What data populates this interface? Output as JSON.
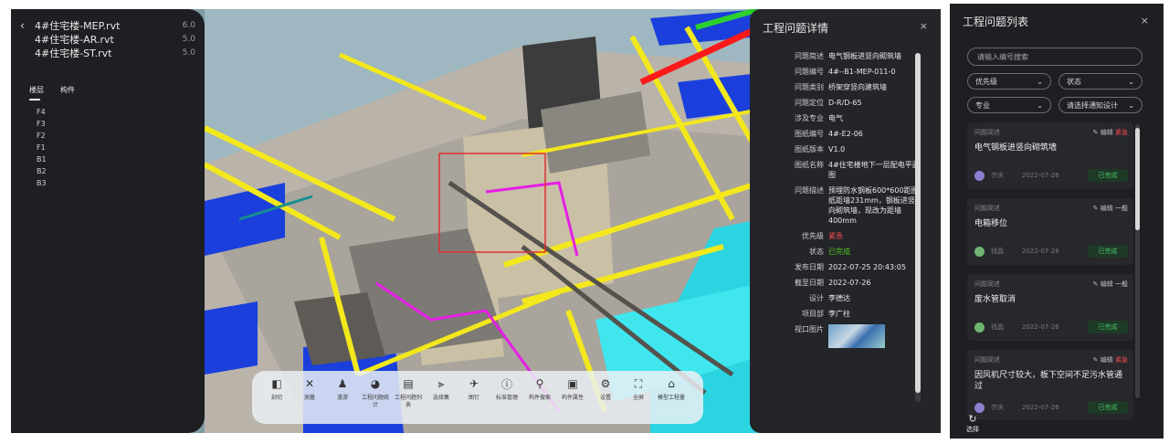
{
  "model_panel": {
    "models": [
      {
        "name": "4#住宅楼-MEP.rvt",
        "version": "6.0"
      },
      {
        "name": "4#住宅楼-AR.rvt",
        "version": "5.0"
      },
      {
        "name": "4#住宅楼-ST.rvt",
        "version": "5.0"
      }
    ],
    "tabs": [
      "楼层",
      "构件"
    ],
    "floors": [
      "F4",
      "F3",
      "F2",
      "F1",
      "B1",
      "B2",
      "B3"
    ]
  },
  "toolbar": {
    "tools": [
      {
        "label": "剖切",
        "icon": "section-icon"
      },
      {
        "label": "测量",
        "icon": "measure-icon"
      },
      {
        "label": "漫游",
        "icon": "walk-icon"
      },
      {
        "label": "工程问题统计",
        "icon": "stats-icon"
      },
      {
        "label": "工程问题列表",
        "icon": "list-icon"
      },
      {
        "label": "选择集",
        "icon": "selection-set-icon"
      },
      {
        "label": "图钉",
        "icon": "pin-icon"
      },
      {
        "label": "标准管理",
        "icon": "info-icon"
      },
      {
        "label": "构件搜索",
        "icon": "search-icon"
      },
      {
        "label": "构件属性",
        "icon": "properties-icon"
      },
      {
        "label": "设置",
        "icon": "gear-icon"
      },
      {
        "label": "全屏",
        "icon": "fullscreen-icon"
      },
      {
        "label": "模型工程量",
        "icon": "quantity-icon"
      }
    ]
  },
  "detail_panel": {
    "title": "工程问题详情",
    "close": "×",
    "rows": [
      {
        "key": "问题简述",
        "value": "电气钢板进竖向砌筑墙",
        "style": ""
      },
      {
        "key": "问题编号",
        "value": "4#--B1-MEP-011-0",
        "style": ""
      },
      {
        "key": "问题类别",
        "value": "桥架穿竖向建筑墙",
        "style": ""
      },
      {
        "key": "问题定位",
        "value": "D-R/D-65",
        "style": ""
      },
      {
        "key": "涉及专业",
        "value": "电气",
        "style": ""
      },
      {
        "key": "图纸编号",
        "value": "4#-E2-06",
        "style": ""
      },
      {
        "key": "图纸版本",
        "value": "V1.0",
        "style": ""
      },
      {
        "key": "图纸名称",
        "value": "4#住宅楼地下一层配电平面图",
        "style": ""
      },
      {
        "key": "问题描述",
        "value": "预埋防水钢板600*600距图纸距墙231mm，钢板进竖向砌筑墙，现改为距墙400mm",
        "style": ""
      },
      {
        "key": "优先级",
        "value": "紧急",
        "style": "red"
      },
      {
        "key": "状态",
        "value": "已完成",
        "style": "green"
      },
      {
        "key": "发布日期",
        "value": "2022-07-25 20:43:05",
        "style": ""
      },
      {
        "key": "截至日期",
        "value": "2022-07-26",
        "style": ""
      },
      {
        "key": "设计",
        "value": "李德达",
        "style": ""
      },
      {
        "key": "项目部",
        "value": "李广柱",
        "style": ""
      },
      {
        "key": "视口图片",
        "value": "",
        "style": "image"
      }
    ]
  },
  "list_panel": {
    "title": "工程问题列表",
    "close": "×",
    "search_placeholder": "请输入编号搜索",
    "filters": {
      "priority": "优先级",
      "status": "状态",
      "discipline": "专业",
      "notify": "请选择通知设计"
    },
    "chevron": "⌄",
    "cards": [
      {
        "title": "问题简述",
        "edit": "编辑",
        "priority": "紧急",
        "priority_style": "red",
        "desc": "电气钢板进竖向砌筑墙",
        "user": "齐庆",
        "date": "2022-07-26",
        "status": "已完成",
        "avatar_color": "#8b7fd1"
      },
      {
        "title": "问题简述",
        "edit": "编辑",
        "priority": "一般",
        "priority_style": "gray",
        "desc": "电箱移位",
        "user": "钱晶",
        "date": "2022-07-26",
        "status": "已完成",
        "avatar_color": "#6fb56f"
      },
      {
        "title": "问题简述",
        "edit": "编辑",
        "priority": "一般",
        "priority_style": "gray",
        "desc": "废水管取消",
        "user": "钱晶",
        "date": "2022-07-26",
        "status": "已完成",
        "avatar_color": "#6fb56f"
      },
      {
        "title": "问题简述",
        "edit": "编辑",
        "priority": "紧急",
        "priority_style": "red",
        "desc": "因风机尺寸较大，板下空间不足污水管通过",
        "user": "齐庆",
        "date": "2022-07-26",
        "status": "已完成",
        "avatar_color": "#8b7fd1"
      }
    ],
    "footer_label": "选择"
  }
}
